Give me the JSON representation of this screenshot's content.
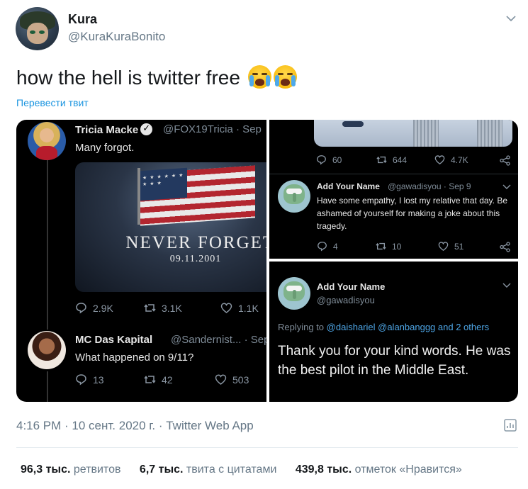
{
  "tweet": {
    "author_name": "Kura",
    "author_handle": "@KuraKuraBonito",
    "text": "how the hell is twitter free",
    "emoji": [
      "loudly-crying-face-emoji",
      "loudly-crying-face-emoji"
    ],
    "translate_label": "Перевести твит",
    "timestamp": "4:16 PM · 10 сент. 2020 г. · Twitter Web App"
  },
  "stats": [
    {
      "count": "96,3 тыс.",
      "label": "ретвитов"
    },
    {
      "count": "6,7 тыс.",
      "label": "твита с цитатами"
    },
    {
      "count": "439,8 тыс.",
      "label": "отметок «Нравится»"
    }
  ],
  "media": {
    "left": {
      "tweet1": {
        "name": "Tricia Macke",
        "handle": "@FOX19Tricia · Sep",
        "text": "Many forgot.",
        "image_title": "NEVER FORGET.",
        "image_date": "09.11.2001",
        "replies": "2.9K",
        "retweets": "3.1K",
        "likes": "1.1K"
      },
      "tweet2": {
        "name": "MC Das Kapital",
        "handle": "@Sandernist... · Sep",
        "text": "What happened on 9/11?",
        "replies": "13",
        "retweets": "42",
        "likes": "503"
      }
    },
    "top_right": {
      "top_actions": {
        "replies": "60",
        "retweets": "644",
        "likes": "4.7K"
      },
      "reply": {
        "name": "Add Your Name",
        "handle": "@gawadisyou · Sep 9",
        "text": "Have some empathy, I lost my relative that day.  Be ashamed of yourself for making a joke about this tragedy.",
        "replies": "4",
        "retweets": "10",
        "likes": "51"
      }
    },
    "bottom_right": {
      "name": "Add Your Name",
      "handle": "@gawadisyou",
      "replying_prefix": "Replying to",
      "replying_to": "@daishariel @alanbanggg and 2 others",
      "text": "Thank you for your kind words. He was the best pilot in the Middle East."
    }
  },
  "colors": {
    "link": "#1b95e0",
    "muted": "#657786",
    "dark_panel": "#000000"
  }
}
